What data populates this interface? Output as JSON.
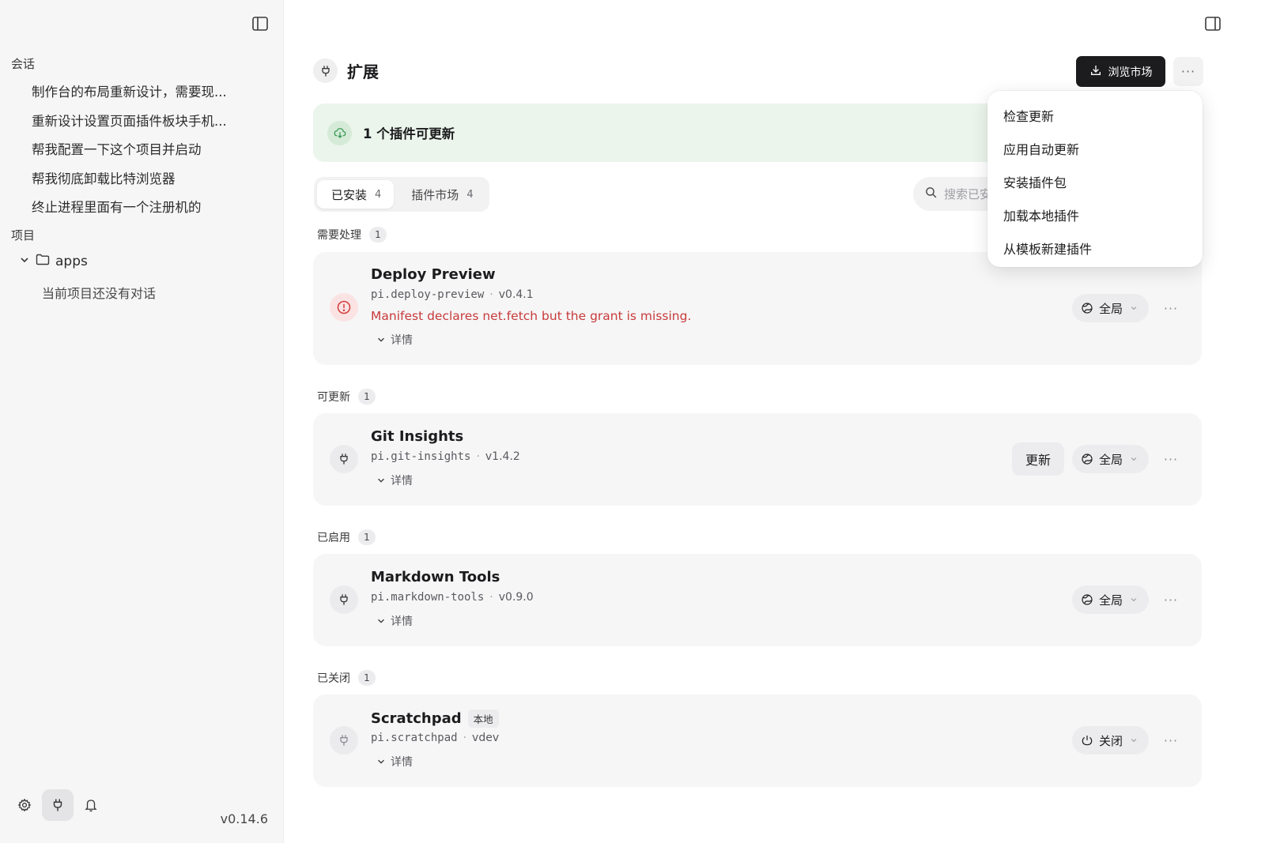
{
  "sidebar": {
    "conversations_label": "会话",
    "conversations": [
      "制作台的布局重新设计，需要现...",
      "重新设计设置页面插件板块手机...",
      "帮我配置一下这个项目并启动",
      "帮我彻底卸载比特浏览器",
      "终止进程里面有一个注册机的"
    ],
    "projects_label": "项目",
    "project_folder": "apps",
    "project_empty": "当前项目还没有对话",
    "version": "v0.14.6"
  },
  "header": {
    "title": "扩展",
    "browse_market": "浏览市场"
  },
  "banner": {
    "text": "1 个插件可更新"
  },
  "tabs": [
    {
      "label": "已安装",
      "count": "4"
    },
    {
      "label": "插件市场",
      "count": "4"
    }
  ],
  "search": {
    "placeholder": "搜索已安装插件"
  },
  "groups": [
    {
      "label": "需要处理",
      "count": "1"
    },
    {
      "label": "可更新",
      "count": "1"
    },
    {
      "label": "已启用",
      "count": "1"
    },
    {
      "label": "已关闭",
      "count": "1"
    }
  ],
  "plugins": [
    {
      "name": "Deploy Preview",
      "id": "pi.deploy-preview",
      "version": "v0.4.1",
      "error": "Manifest declares net.fetch but the grant is missing.",
      "details": "详情",
      "scope": "全局"
    },
    {
      "name": "Git Insights",
      "id": "pi.git-insights",
      "version": "v1.4.2",
      "details": "详情",
      "update": "更新",
      "scope": "全局"
    },
    {
      "name": "Markdown Tools",
      "id": "pi.markdown-tools",
      "version": "v0.9.0",
      "details": "详情",
      "scope": "全局"
    },
    {
      "name": "Scratchpad",
      "tag": "本地",
      "id": "pi.scratchpad",
      "version": "vdev",
      "details": "详情",
      "scope": "关闭"
    }
  ],
  "menu": [
    "检查更新",
    "应用自动更新",
    "安装插件包",
    "加载本地插件",
    "从模板新建插件"
  ],
  "colors": {
    "banner_bg": "#ebf5ec",
    "error": "#c83a3a",
    "primary_button": "#1c1c1e"
  }
}
